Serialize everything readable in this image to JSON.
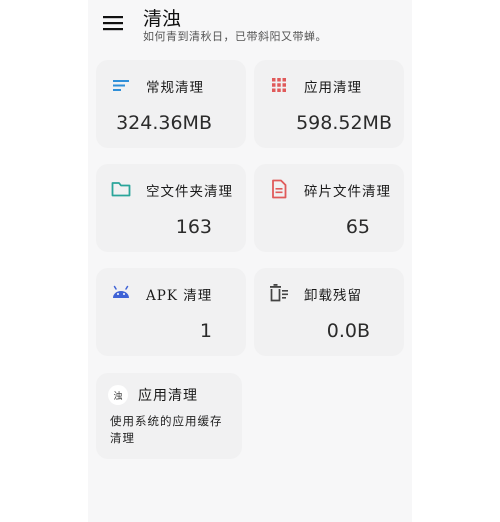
{
  "header": {
    "title": "清浊",
    "subtitle": "如何青到清秋日，已带斜阳又带蝉。"
  },
  "cards": [
    {
      "label": "常规清理",
      "value": "324.36MB",
      "icon": "list-lines-icon",
      "icon_color": "#2f8fd8"
    },
    {
      "label": "应用清理",
      "value": "598.52MB",
      "icon": "grid-dots-icon",
      "icon_color": "#e05a5a"
    },
    {
      "label": "空文件夹清理",
      "value": "163",
      "icon": "folder-icon",
      "icon_color": "#2aa59a"
    },
    {
      "label": "碎片文件清理",
      "value": "65",
      "icon": "document-icon",
      "icon_color": "#e05a5a"
    },
    {
      "label": "APK 清理",
      "value": "1",
      "icon": "android-icon",
      "icon_color": "#3f63d6"
    },
    {
      "label": "卸载残留",
      "value": "0.0B",
      "icon": "uninstall-trash-icon",
      "icon_color": "#444444"
    }
  ],
  "app_card": {
    "badge": "浊",
    "label": "应用清理",
    "description": "使用系统的应用缓存清理"
  }
}
